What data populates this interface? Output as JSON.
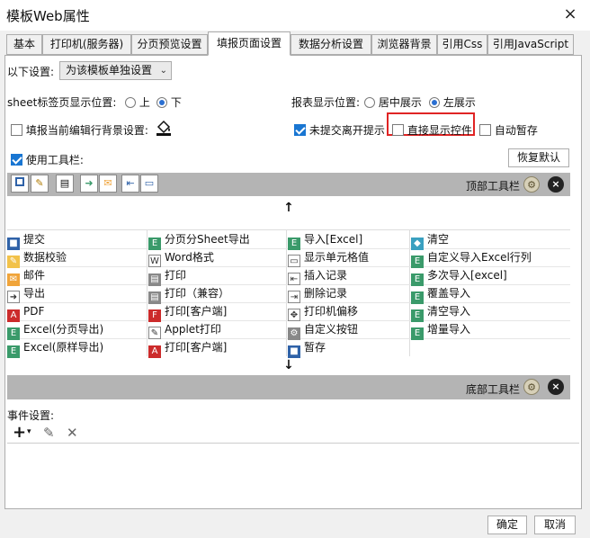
{
  "window": {
    "title": "模板Web属性",
    "close_icon": "×"
  },
  "tabs": [
    {
      "label": "基本"
    },
    {
      "label": "打印机(服务器)"
    },
    {
      "label": "分页预览设置"
    },
    {
      "label": "填报页面设置",
      "active": true
    },
    {
      "label": "数据分析设置"
    },
    {
      "label": "浏览器背景"
    },
    {
      "label": "引用Css"
    },
    {
      "label": "引用JavaScript"
    }
  ],
  "settings": {
    "label": "以下设置:",
    "select_value": "为该模板单独设置",
    "sheet_label": "sheet标签页显示位置:",
    "sheet_top": "上",
    "sheet_bottom": "下",
    "report_label": "报表显示位置:",
    "report_center": "居中展示",
    "report_left": "左展示",
    "fill_bg_label": "填报当前编辑行背景设置:",
    "unsubmitted_label": "未提交离开提示",
    "direct_controls_label": "直接显示控件",
    "autosave_label": "自动暂存",
    "use_toolbar_label": "使用工具栏:",
    "restore_default": "恢复默认"
  },
  "toolbar": {
    "top_label": "顶部工具栏",
    "bottom_label": "底部工具栏",
    "up_arrow": "↑",
    "down_arrow": "↓"
  },
  "grid": {
    "col1": [
      "提交",
      "数据校验",
      "邮件",
      "导出",
      "PDF",
      "Excel(分页导出)",
      "Excel(原样导出)"
    ],
    "col2": [
      "分页分Sheet导出",
      "Word格式",
      "打印",
      "打印（兼容）",
      "打印[客户端]",
      "Applet打印",
      "打印[客户端]"
    ],
    "col3": [
      "导入[Excel]",
      "显示单元格值",
      "插入记录",
      "删除记录",
      "打印机偏移",
      "自定义按钮",
      "暂存"
    ],
    "col4": [
      "清空",
      "自定义导入Excel行列",
      "多次导入[excel]",
      "覆盖导入",
      "清空导入",
      "增量导入"
    ]
  },
  "events": {
    "label": "事件设置:",
    "add_icon": "+",
    "edit_icon": "✎",
    "delete_icon": "✕"
  },
  "footer": {
    "ok": "确定",
    "cancel": "取消"
  },
  "colors": {
    "highlight": "#e02424",
    "toolbar_bg": "#b4b4b4",
    "checkbox": "#1976d2"
  }
}
